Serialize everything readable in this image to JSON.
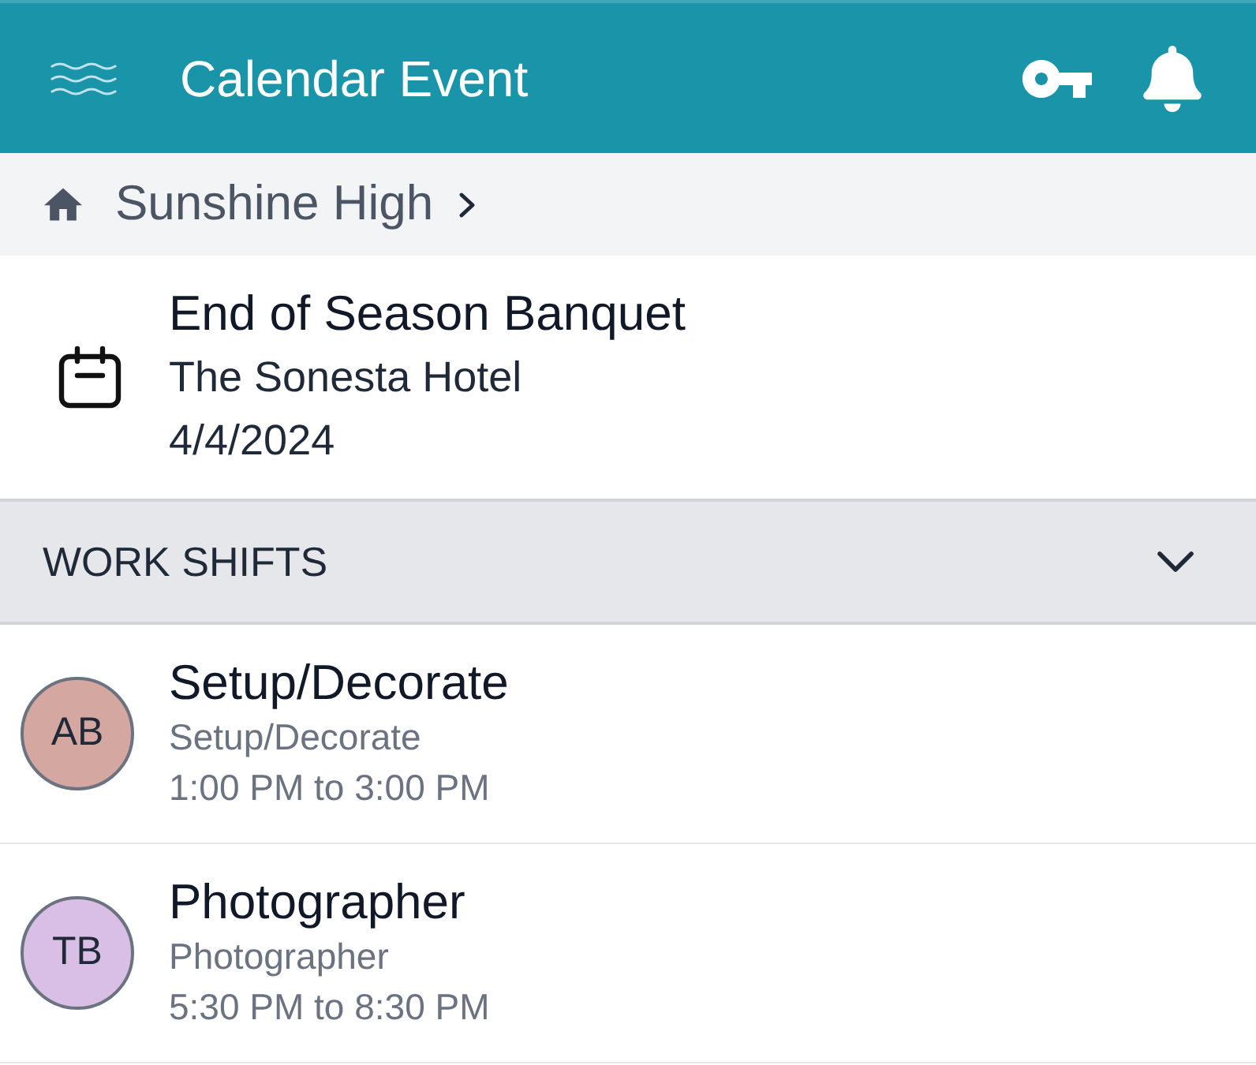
{
  "header": {
    "title": "Calendar Event"
  },
  "breadcrumb": {
    "label": "Sunshine High"
  },
  "event": {
    "title": "End of Season Banquet",
    "location": "The Sonesta Hotel",
    "date": "4/4/2024"
  },
  "section": {
    "title": "WORK SHIFTS",
    "expanded": true
  },
  "shifts": [
    {
      "initials": "AB",
      "color": "#d5a7a1",
      "title": "Setup/Decorate",
      "role": "Setup/Decorate",
      "time": "1:00 PM to 3:00 PM"
    },
    {
      "initials": "TB",
      "color": "#d9bfe6",
      "title": "Photographer",
      "role": "Photographer",
      "time": "5:30 PM to 8:30 PM"
    }
  ]
}
